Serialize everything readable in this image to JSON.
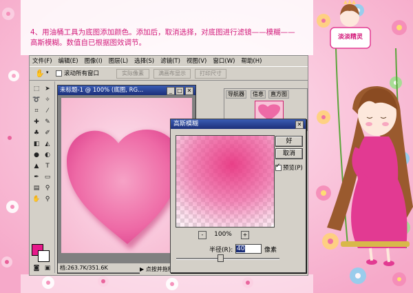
{
  "instruction": {
    "line1": "4、用油桶工具为底图添加颜色。添加后，取消选择，对底图进行滤镜——模糊——",
    "line2": "高斯模糊。数值自已根据图效调节。"
  },
  "logo_text": "淡淡精灵",
  "menu": [
    "文件(F)",
    "编辑(E)",
    "图像(I)",
    "图层(L)",
    "选择(S)",
    "滤镜(T)",
    "视图(V)",
    "窗口(W)",
    "帮助(H)"
  ],
  "options": {
    "scroll_all_label": "滚动所有窗口",
    "actual_pixels": "实际像素",
    "fit_screen": "满画布显示",
    "print_size": "打印尺寸"
  },
  "document": {
    "title": "未标题-1 @ 100% (底图, RG...",
    "status": "档:263.7K/351.6K"
  },
  "navigator": {
    "tabs": [
      "导航器",
      "信息",
      "直方图"
    ]
  },
  "status_hint": "点按并拖移以沿想要的方向",
  "dialog": {
    "title": "高斯模糊",
    "ok": "好",
    "cancel": "取消",
    "preview_label": "预览(P)",
    "zoom": "100%",
    "zoom_minus": "-",
    "zoom_plus": "+",
    "radius_label": "半径(R):",
    "radius_value": "40",
    "unit": "像素"
  },
  "colors": {
    "foreground": "#e6198a",
    "accent": "#d21a7a"
  }
}
